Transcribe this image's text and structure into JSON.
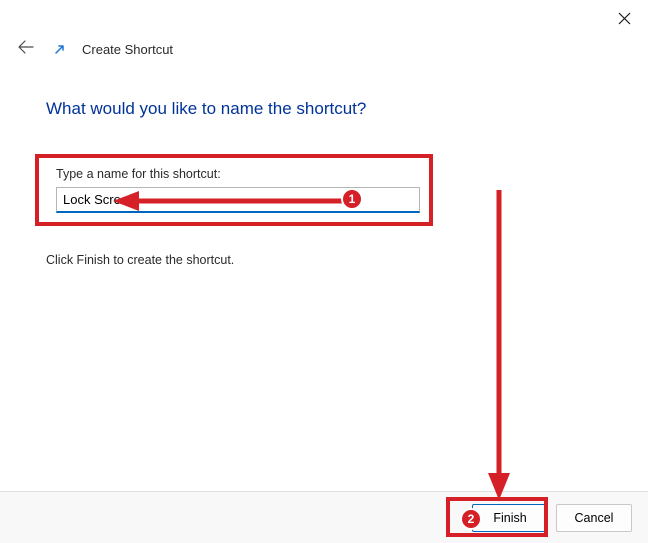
{
  "window": {
    "title": "Create Shortcut"
  },
  "heading": "What would you like to name the shortcut?",
  "input": {
    "label": "Type a name for this shortcut:",
    "value": "Lock Screen"
  },
  "help_text": "Click Finish to create the shortcut.",
  "buttons": {
    "finish": "Finish",
    "cancel": "Cancel"
  },
  "annotations": {
    "badge1": "1",
    "badge2": "2",
    "color": "#d62027"
  }
}
